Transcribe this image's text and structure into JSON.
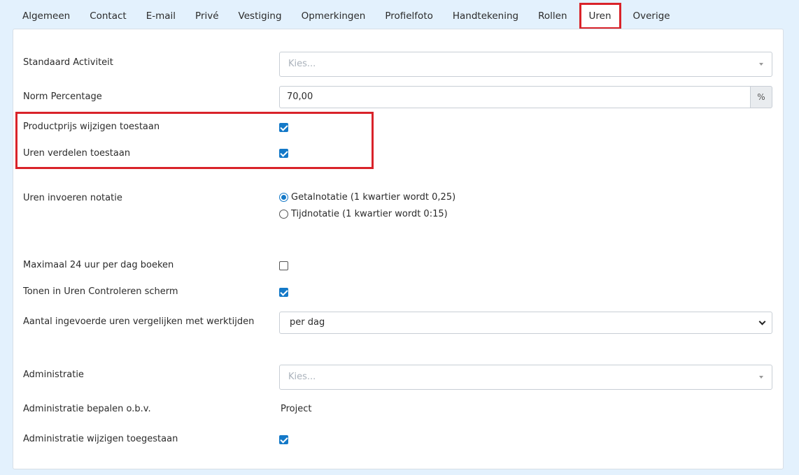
{
  "tabs": [
    {
      "label": "Algemeen"
    },
    {
      "label": "Contact"
    },
    {
      "label": "E-mail"
    },
    {
      "label": "Privé"
    },
    {
      "label": "Vestiging"
    },
    {
      "label": "Opmerkingen"
    },
    {
      "label": "Profielfoto"
    },
    {
      "label": "Handtekening"
    },
    {
      "label": "Rollen"
    },
    {
      "label": "Uren",
      "active": true
    },
    {
      "label": "Overige"
    }
  ],
  "form": {
    "standaard_activiteit": {
      "label": "Standaard Activiteit",
      "placeholder": "Kies..."
    },
    "norm_percentage": {
      "label": "Norm Percentage",
      "value": "70,00",
      "addon": "%"
    },
    "productprijs": {
      "label": "Productprijs wijzigen toestaan",
      "checked": true
    },
    "uren_verdelen": {
      "label": "Uren verdelen toestaan",
      "checked": true
    },
    "notatie": {
      "label": "Uren invoeren notatie",
      "options": [
        {
          "label": "Getalnotatie (1 kwartier wordt 0,25)",
          "selected": true
        },
        {
          "label": "Tijdnotatie (1 kwartier wordt 0:15)",
          "selected": false
        }
      ]
    },
    "max24": {
      "label": "Maximaal 24 uur per dag boeken",
      "checked": false
    },
    "tonen_controleren": {
      "label": "Tonen in Uren Controleren scherm",
      "checked": true
    },
    "vergelijken": {
      "label": "Aantal ingevoerde uren vergelijken met werktijden",
      "value": "per dag"
    },
    "administratie": {
      "label": "Administratie",
      "placeholder": "Kies..."
    },
    "administratie_obv": {
      "label": "Administratie bepalen o.b.v.",
      "value": "Project"
    },
    "administratie_wijzigen": {
      "label": "Administratie wijzigen toegestaan",
      "checked": true
    }
  },
  "colors": {
    "highlight": "#d9232a",
    "accent": "#1479c8",
    "background": "#e3f1fd"
  }
}
